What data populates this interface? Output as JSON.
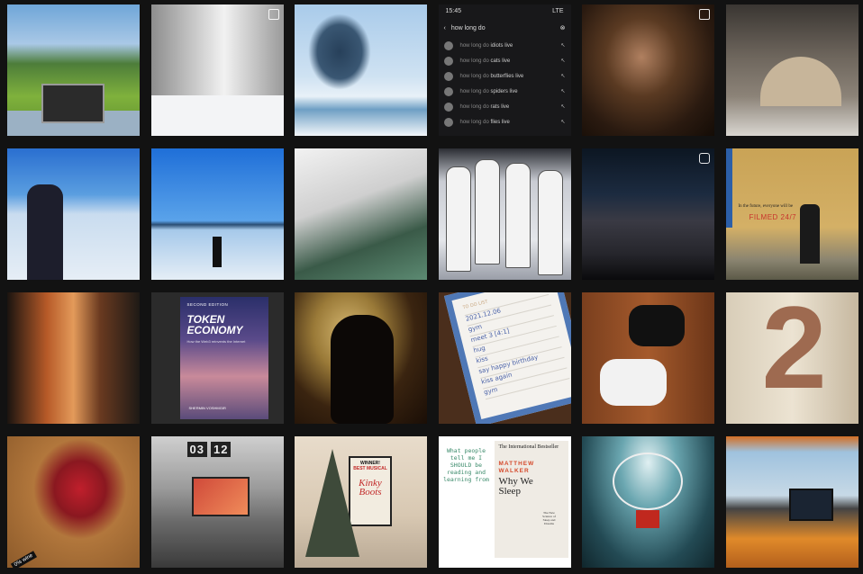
{
  "grid": {
    "background": "#121212",
    "tiles": [
      {
        "subject": "park"
      },
      {
        "subject": "snowy-road",
        "badge": "carousel-icon"
      },
      {
        "subject": "frozen-lake"
      },
      {
        "subject": "phone-screenshot",
        "phone": {
          "time": "15:45",
          "network": "LTE",
          "query": "how long do",
          "suggestions": [
            {
              "prefix": "how long do",
              "suffix": " idiots live"
            },
            {
              "prefix": "how long do",
              "suffix": " cats live"
            },
            {
              "prefix": "how long do",
              "suffix": " butterflies live"
            },
            {
              "prefix": "how long do",
              "suffix": " spiders live"
            },
            {
              "prefix": "how long do",
              "suffix": " rats live"
            },
            {
              "prefix": "how long do",
              "suffix": " flies live"
            }
          ]
        }
      },
      {
        "subject": "sauna",
        "badge": "carousel-icon"
      },
      {
        "subject": "yurt"
      },
      {
        "subject": "winter-sea-person"
      },
      {
        "subject": "ice-horizon"
      },
      {
        "subject": "snow-tree"
      },
      {
        "subject": "basketball-team"
      },
      {
        "subject": "night-road",
        "badge": "reel-icon"
      },
      {
        "subject": "graffiti-wall",
        "quote": "In the future, everyone will be",
        "highlight": "FILMED 24/7"
      },
      {
        "subject": "shop-window"
      },
      {
        "subject": "book",
        "book": {
          "edition": "SECOND EDITION",
          "title_line1": "TOKEN",
          "title_line2": "ECONOMY",
          "subtitle": "How the Web3 reinvents the Internet",
          "author": "SHERMIN VOSHMGIR"
        }
      },
      {
        "subject": "hooded-figure"
      },
      {
        "subject": "todo-list",
        "todo": {
          "header": "TO DO LIST",
          "date": "2021.12.06",
          "items": [
            "gym",
            "meet 3 [4:1]",
            "hug",
            "kiss",
            "say happy birthday",
            "kiss again",
            "gym"
          ]
        }
      },
      {
        "subject": "game-controllers"
      },
      {
        "subject": "number-balloon",
        "number": "2"
      },
      {
        "subject": "roses",
        "label": "0% wine"
      },
      {
        "subject": "desk-setup",
        "clock": [
          "03",
          "12"
        ]
      },
      {
        "subject": "christmas-tree",
        "poster": {
          "headline": "WINNER!",
          "sub": "BEST MUSICAL",
          "title": "Kinky Boots"
        }
      },
      {
        "subject": "book-why-we-sleep",
        "note": "What people tell me I SHOULD be reading and learning from",
        "book": {
          "banner": "The International Bestseller",
          "author_line1": "MATTHEW",
          "author_line2": "WALKER",
          "title_line1": "Why We",
          "title_line2": "Sleep",
          "subtitle": "The New Science of Sleep and Dreams"
        }
      },
      {
        "subject": "basketball-hoop"
      },
      {
        "subject": "home-office"
      }
    ]
  }
}
